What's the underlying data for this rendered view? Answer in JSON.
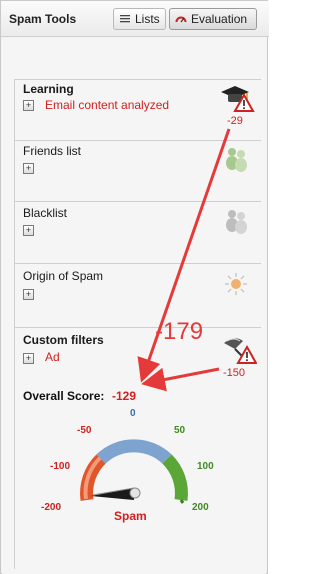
{
  "header": {
    "title": "Spam Tools",
    "tabs": [
      {
        "label": "Lists",
        "icon": "list-icon"
      },
      {
        "label": "Evaluation",
        "icon": "gauge-icon",
        "active": true
      }
    ]
  },
  "sections": {
    "learning": {
      "title": "Learning",
      "detail": "Email content analyzed",
      "score": "-29",
      "icon": "graduation-cap-warning-icon"
    },
    "friends": {
      "title": "Friends list",
      "icon": "people-icon"
    },
    "blacklist": {
      "title": "Blacklist",
      "icon": "people-icon"
    },
    "origin": {
      "title": "Origin of Spam",
      "icon": "sun-icon"
    },
    "custom": {
      "title": "Custom filters",
      "detail": "Ad",
      "score": "-150",
      "icon": "filter-warning-icon"
    }
  },
  "overall": {
    "label": "Overall Score:",
    "value": "-129"
  },
  "annotation": {
    "text": "-179"
  },
  "gauge": {
    "ticks": [
      "-200",
      "-100",
      "-50",
      "0",
      "50",
      "100",
      "200"
    ],
    "label": "Spam",
    "value": -129,
    "colors": {
      "negative": "#e0562a",
      "neutral": "#7fa3cf",
      "positive": "#5aa637",
      "label": "#d12020"
    }
  },
  "colors": {
    "accent": "#d12020",
    "arrow": "#e53a3a"
  }
}
